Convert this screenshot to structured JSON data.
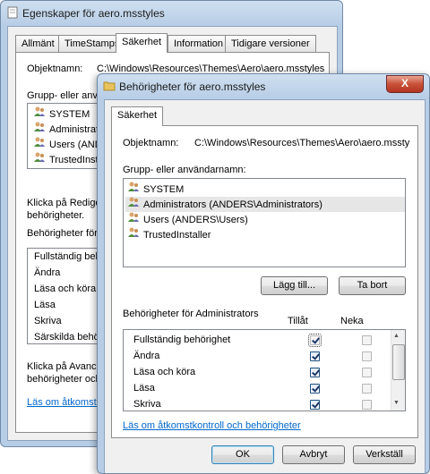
{
  "back_window": {
    "title": "Egenskaper för aero.msstyles",
    "close_label": "X",
    "tabs": [
      "Allmänt",
      "TimeStamps",
      "Säkerhet",
      "Information",
      "Tidigare versioner"
    ],
    "object_label": "Objektnamn:",
    "object_value": "C:\\Windows\\Resources\\Themes\\Aero\\aero.msstyles",
    "group_label": "Grupp- eller anvä",
    "users": [
      "SYSTEM",
      "Administrato",
      "Users (ANDE",
      "TrustedInstall"
    ],
    "edit_hint_1": "Klicka på Redige",
    "edit_hint_2": "behörigheter.",
    "perm_label": "Behörigheter för A",
    "perms": [
      "Fullständig beh",
      "Ändra",
      "Läsa och köra",
      "Läsa",
      "Skriva",
      "Särskilda behö"
    ],
    "adv_hint_1": "Klicka på Avance",
    "adv_hint_2": "behörigheter och",
    "link": "Läs om åtkomstk"
  },
  "front_window": {
    "title": "Behörigheter för aero.msstyles",
    "close_label": "X",
    "tab": "Säkerhet",
    "object_label": "Objektnamn:",
    "object_value": "C:\\Windows\\Resources\\Themes\\Aero\\aero.mssty",
    "group_label": "Grupp- eller användarnamn:",
    "users": [
      "SYSTEM",
      "Administrators (ANDERS\\Administrators)",
      "Users (ANDERS\\Users)",
      "TrustedInstaller"
    ],
    "selected_user_index": 1,
    "add_button": "Lägg till...",
    "remove_button": "Ta bort",
    "perm_label": "Behörigheter för Administrators",
    "allow_header": "Tillåt",
    "deny_header": "Neka",
    "permissions": [
      {
        "name": "Fullständig behörighet",
        "allow": true,
        "deny": false
      },
      {
        "name": "Ändra",
        "allow": true,
        "deny": false
      },
      {
        "name": "Läsa och köra",
        "allow": true,
        "deny": false
      },
      {
        "name": "Läsa",
        "allow": true,
        "deny": false
      },
      {
        "name": "Skriva",
        "allow": true,
        "deny": false
      }
    ],
    "link": "Läs om åtkomstkontroll och behörigheter",
    "ok_button": "OK",
    "cancel_button": "Avbryt",
    "apply_button": "Verkställ"
  },
  "colors": {
    "link": "#0066cc",
    "close": "#c9523a",
    "window_frame": "#b7cde6"
  }
}
